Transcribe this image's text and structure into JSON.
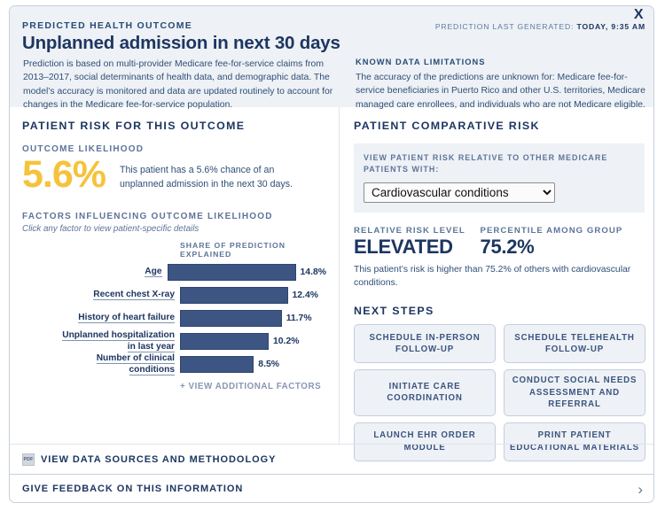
{
  "header": {
    "eyebrow": "PREDICTED HEALTH OUTCOME",
    "timestamp_label": "PREDICTION LAST GENERATED: ",
    "timestamp_value": "TODAY, 9:35 AM",
    "close_label": "X",
    "title": "Unplanned admission in next 30 days",
    "description": "Prediction is based on multi-provider Medicare fee-for-service claims from 2013–2017, social determinants of health data, and demographic data. The model’s accuracy is monitored and data are updated routinely to account for changes in the Medicare fee-for-service population.",
    "limitations_title": "KNOWN DATA LIMITATIONS",
    "limitations_body": "The accuracy of the predictions are unknown for: Medicare fee-for-service beneficiaries in Puerto Rico and other U.S. territories, Medicare managed care enrollees, and individuals who are not Medicare eligible."
  },
  "left_panel": {
    "section_title": "PATIENT RISK FOR THIS OUTCOME",
    "likelihood_label": "OUTCOME LIKELIHOOD",
    "likelihood_value": "5.6%",
    "likelihood_text": "This patient has a 5.6% chance of an unplanned admission in the next 30 days.",
    "factors_title": "FACTORS INFLUENCING OUTCOME LIKELIHOOD",
    "factors_hint": "Click any factor to view patient-specific details",
    "more_factors": "+ VIEW ADDITIONAL FACTORS"
  },
  "chart_data": {
    "type": "bar",
    "title": "FACTORS INFLUENCING OUTCOME LIKELIHOOD",
    "xlabel": "SHARE OF PREDICTION EXPLAINED",
    "ylabel": "",
    "orientation": "horizontal",
    "grid": false,
    "xlim": [
      0,
      16
    ],
    "categories": [
      "Age",
      "Recent chest X-ray",
      "History of heart failure",
      "Unplanned hospitalization in last year",
      "Number of clinical conditions"
    ],
    "category_lines": [
      [
        "Age"
      ],
      [
        "Recent chest X-ray"
      ],
      [
        "History of heart failure"
      ],
      [
        "Unplanned hospitalization",
        "in last year"
      ],
      [
        "Number of clinical",
        "conditions"
      ]
    ],
    "values": [
      14.8,
      12.4,
      11.7,
      10.2,
      8.5
    ],
    "value_labels": [
      "14.8%",
      "12.4%",
      "11.7%",
      "10.2%",
      "8.5%"
    ],
    "bar_color": "#3c5582"
  },
  "right_panel": {
    "section_title": "PATIENT COMPARATIVE RISK",
    "select_label": "VIEW PATIENT RISK RELATIVE TO OTHER MEDICARE PATIENTS WITH:",
    "select_value": "Cardiovascular conditions",
    "select_options": [
      "Cardiovascular conditions"
    ],
    "risk_level_label": "RELATIVE RISK LEVEL",
    "risk_level_value": "ELEVATED",
    "percentile_label": "PERCENTILE AMONG GROUP",
    "percentile_value": "75.2%",
    "risk_description": "This patient’s risk is higher than 75.2% of others with cardiovascular conditions.",
    "next_steps_title": "NEXT STEPS",
    "next_steps": [
      "SCHEDULE IN-PERSON FOLLOW-UP",
      "SCHEDULE TELEHEALTH FOLLOW-UP",
      "INITIATE CARE COORDINATION",
      "CONDUCT SOCIAL NEEDS ASSESSMENT AND REFERRAL",
      "LAUNCH EHR ORDER MODULE",
      "PRINT PATIENT EDUCATIONAL MATERIALS"
    ]
  },
  "footer": {
    "pdf_icon_label": "PDF",
    "data_sources_label": "VIEW DATA SOURCES AND METHODOLOGY",
    "feedback_label": "GIVE FEEDBACK ON THIS INFORMATION",
    "chevron": "›"
  },
  "colors": {
    "navy": "#1d3661",
    "bar": "#3c5582",
    "accent_yellow": "#f5c33b",
    "panel_bg": "#eef1f5"
  }
}
